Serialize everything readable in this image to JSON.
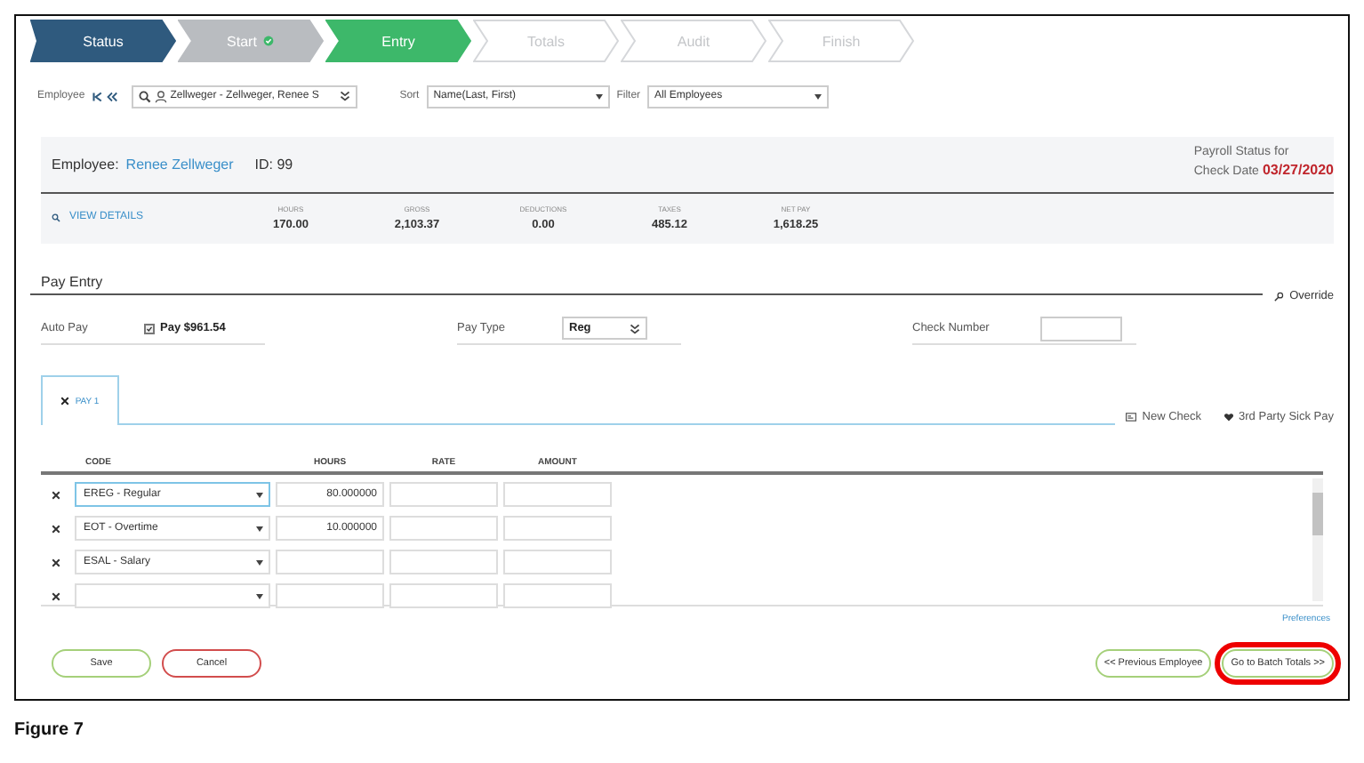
{
  "steps": [
    {
      "label": "Status",
      "visited": true,
      "done": false,
      "selected": false
    },
    {
      "label": "Start",
      "visited": false,
      "done": true,
      "selected": false
    },
    {
      "label": "Entry",
      "visited": false,
      "done": false,
      "selected": true
    },
    {
      "label": "Totals",
      "visited": false,
      "done": false,
      "selected": false
    },
    {
      "label": "Audit",
      "visited": false,
      "done": false,
      "selected": false
    },
    {
      "label": "Finish",
      "visited": false,
      "done": false,
      "selected": false
    }
  ],
  "toolbar": {
    "employee_label": "Employee",
    "employee_value": "Zellweger - Zellweger, Renee S",
    "sort_label": "Sort",
    "sort_value": "Name(Last, First)",
    "filter_label": "Filter",
    "filter_value": "All Employees"
  },
  "employee": {
    "label": "Employee:",
    "name": "Renee Zellweger",
    "id": "ID: 99",
    "status_title": "Payroll Status for",
    "check_date_label": "Check Date",
    "check_date": "03/27/2020",
    "view_details": "VIEW DETAILS",
    "summary": [
      {
        "label": "HOURS",
        "value": "170.00"
      },
      {
        "label": "GROSS",
        "value": "2,103.37"
      },
      {
        "label": "DEDUCTIONS",
        "value": "0.00"
      },
      {
        "label": "TAXES",
        "value": "485.12"
      },
      {
        "label": "NET PAY",
        "value": "1,618.25"
      }
    ]
  },
  "pay_entry": {
    "title": "Pay Entry",
    "override": "Override",
    "auto_pay_label": "Auto Pay",
    "auto_pay_checked": true,
    "auto_pay_text": "Pay $961.54",
    "pay_type_label": "Pay Type",
    "pay_type": "Reg",
    "check_number_label": "Check Number"
  },
  "tabs": [
    {
      "label": "PAY 1",
      "selected": true
    }
  ],
  "new_check": "New Check",
  "sick_pay": "3rd Party Sick Pay",
  "grid": {
    "columns": [
      "CODE",
      "HOURS",
      "RATE",
      "AMOUNT"
    ],
    "rows": [
      {
        "code": "EREG - Regular",
        "hours": "80.000000",
        "focused": true
      },
      {
        "code": "EOT - Overtime",
        "hours": "10.000000",
        "focused": false
      },
      {
        "code": "ESAL - Salary",
        "focused": false
      },
      {
        "focused": false
      }
    ]
  },
  "preferences": "Preferences",
  "left_buttons": [
    {
      "label": "Save",
      "kind": "save"
    },
    {
      "label": "Cancel",
      "kind": "cancel"
    }
  ],
  "right_buttons": [
    {
      "label": "<< Previous Employee",
      "highlighted": false
    },
    {
      "label": "Go to Batch Totals >>",
      "highlighted": true
    }
  ],
  "caption": "Figure 7"
}
